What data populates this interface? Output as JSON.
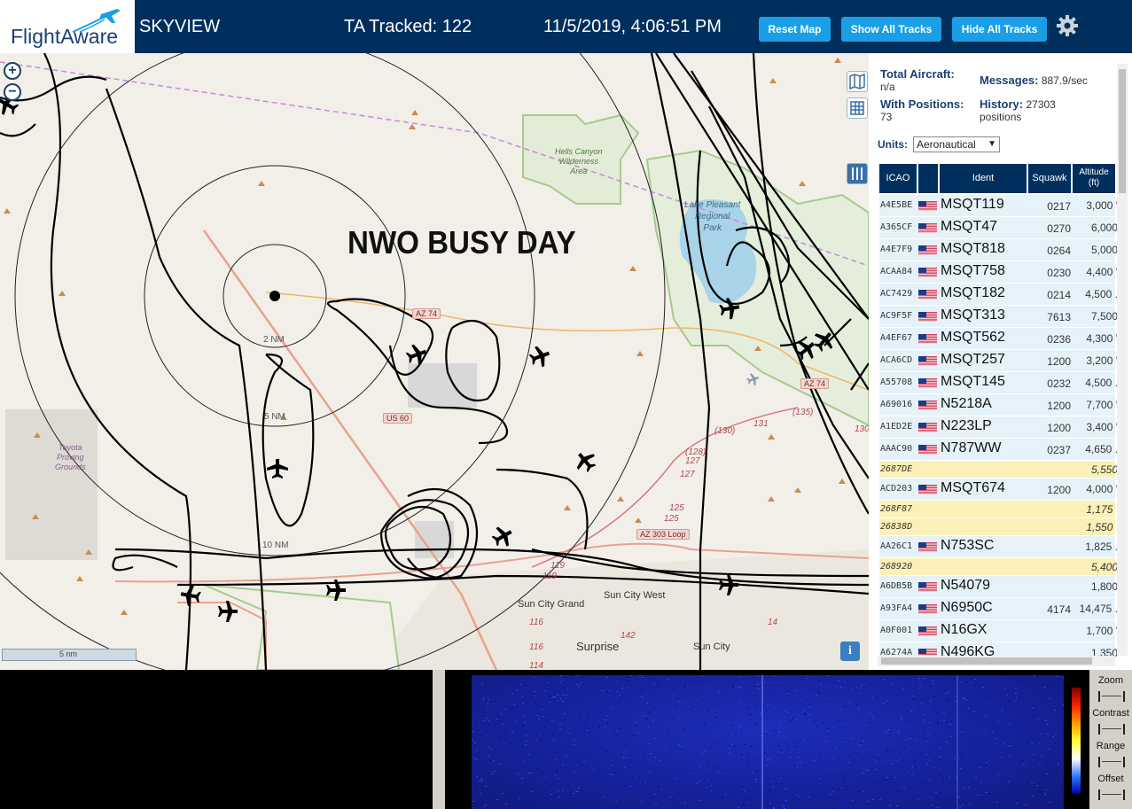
{
  "header": {
    "logo_text": "FlightAware",
    "app_name": "SKYVIEW",
    "ta_tracked": "TA Tracked: 122",
    "clock": "11/5/2019, 4:06:51 PM",
    "reset_map": "Reset Map",
    "show_all_tracks": "Show All Tracks",
    "hide_all_tracks": "Hide All Tracks"
  },
  "map": {
    "overlay_title": "NWO BUSY DAY",
    "range_rings": [
      "2 NM",
      "5 NM",
      "10 NM"
    ],
    "places": {
      "hells_canyon": "Hells Canyon\nWilderness\nArea",
      "lake_pleasant": "Lake Pleasant\nRegional\nPark",
      "toyota": "Toyota\nProving\nGrounds",
      "sun_city_grand": "Sun City Grand",
      "sun_city_west": "Sun City West",
      "surprise": "Surprise",
      "sun_city": "Sun City"
    },
    "roads": {
      "az74_a": "AZ 74",
      "az74_b": "AZ 74",
      "us60": "US 60",
      "az303": "AZ 303 Loop"
    },
    "route_numbers": [
      "(135)",
      "(130)",
      "131",
      "130",
      "(128)",
      "127",
      "127",
      "125",
      "125",
      "119",
      "119",
      "116",
      "116",
      "142",
      "114",
      "14"
    ],
    "scale_label": "5 nm",
    "zoom_in": "+",
    "zoom_out": "−",
    "info": "i"
  },
  "stats": {
    "total_aircraft_label": "Total Aircraft:",
    "total_aircraft_value": "n/a",
    "with_positions_label": "With Positions:",
    "with_positions_value": "73",
    "messages_label": "Messages:",
    "messages_value": "887.9/sec",
    "history_label": "History:",
    "history_value": "27303",
    "history_unit": "positions"
  },
  "units": {
    "label": "Units:",
    "selected": "Aeronautical"
  },
  "table": {
    "headers": {
      "icao": "ICAO",
      "ident": "Ident",
      "squawk": "Squawk",
      "altitude": "Altitude (ft)"
    },
    "rows": [
      {
        "icao": "A4E5BE",
        "flag": true,
        "ident": "MSQT119",
        "squawk": "0217",
        "alt": "3,000 '"
      },
      {
        "icao": "A365CF",
        "flag": true,
        "ident": "MSQT47",
        "squawk": "0270",
        "alt": "6,000 "
      },
      {
        "icao": "A4E7F9",
        "flag": true,
        "ident": "MSQT818",
        "squawk": "0264",
        "alt": "5,000 "
      },
      {
        "icao": "ACAA84",
        "flag": true,
        "ident": "MSQT758",
        "squawk": "0230",
        "alt": "4,400 '"
      },
      {
        "icao": "AC7429",
        "flag": true,
        "ident": "MSQT182",
        "squawk": "0214",
        "alt": "4,500 ."
      },
      {
        "icao": "AC9F5F",
        "flag": true,
        "ident": "MSQT313",
        "squawk": "7613",
        "alt": "7,500 "
      },
      {
        "icao": "A4EF67",
        "flag": true,
        "ident": "MSQT562",
        "squawk": "0236",
        "alt": "4,300 '"
      },
      {
        "icao": "ACA6CD",
        "flag": true,
        "ident": "MSQT257",
        "squawk": "1200",
        "alt": "3,200 '"
      },
      {
        "icao": "A55708",
        "flag": true,
        "ident": "MSQT145",
        "squawk": "0232",
        "alt": "4,500 ."
      },
      {
        "icao": "A69016",
        "flag": true,
        "ident": "N5218A",
        "squawk": "1200",
        "alt": "7,700 '"
      },
      {
        "icao": "A1ED2E",
        "flag": true,
        "ident": "N223LP",
        "squawk": "1200",
        "alt": "3,400 '"
      },
      {
        "icao": "AAAC90",
        "flag": true,
        "ident": "N787WW",
        "squawk": "0237",
        "alt": "4,650 ."
      },
      {
        "icao": "2687DE",
        "flag": false,
        "ident": "",
        "squawk": "",
        "alt": "5,550 "
      },
      {
        "icao": "ACD203",
        "flag": true,
        "ident": "MSQT674",
        "squawk": "1200",
        "alt": "4,000 '"
      },
      {
        "icao": "268F87",
        "flag": false,
        "ident": "",
        "squawk": "",
        "alt": "1,175 '"
      },
      {
        "icao": "26838D",
        "flag": false,
        "ident": "",
        "squawk": "",
        "alt": "1,550 '"
      },
      {
        "icao": "AA26C1",
        "flag": true,
        "ident": "N753SC",
        "squawk": "",
        "alt": "1,825 ."
      },
      {
        "icao": "268920",
        "flag": false,
        "ident": "",
        "squawk": "",
        "alt": "5,400 "
      },
      {
        "icao": "A6DB5B",
        "flag": true,
        "ident": "N54079",
        "squawk": "",
        "alt": "1,800 "
      },
      {
        "icao": "A93FA4",
        "flag": true,
        "ident": "N6950C",
        "squawk": "4174",
        "alt": "14,475 ."
      },
      {
        "icao": "A0F001",
        "flag": true,
        "ident": "N16GX",
        "squawk": "",
        "alt": "1,700 '"
      },
      {
        "icao": "A6274A",
        "flag": true,
        "ident": "N496KG",
        "squawk": "",
        "alt": "1,350 "
      }
    ]
  },
  "waterfall": {
    "zoom": "Zoom",
    "contrast": "Contrast",
    "range": "Range",
    "offset": "Offset"
  },
  "colors": {
    "header_bg": "#002f5d",
    "button_bg": "#1a9fe6",
    "row_bg": "#e6f2fa",
    "row_nopos_bg": "#fbf0b7",
    "track": "#000000",
    "range_ring": "#222222"
  }
}
